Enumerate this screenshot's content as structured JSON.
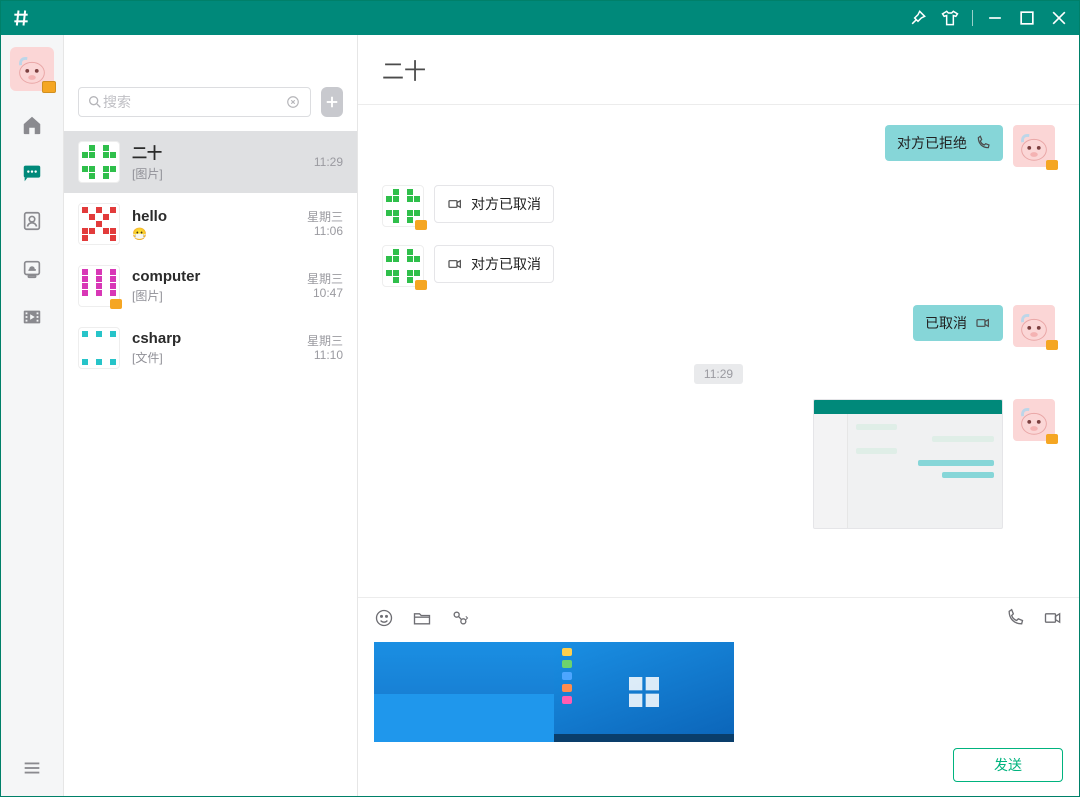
{
  "colors": {
    "brand": "#00897a",
    "bubble_right": "#86d6d8",
    "send_border": "#00b37e"
  },
  "titlebar": {
    "logo_name": "logo-icon"
  },
  "search": {
    "placeholder": "搜索"
  },
  "chat_title": "二十",
  "conversations": [
    {
      "name": "二十",
      "preview": "[图片]",
      "time1": "",
      "time2": "11:29",
      "avatar": "green",
      "active": true
    },
    {
      "name": "hello",
      "preview": "😷",
      "time1": "星期三",
      "time2": "11:06",
      "avatar": "red",
      "active": false
    },
    {
      "name": "computer",
      "preview": "[图片]",
      "time1": "星期三",
      "time2": "10:47",
      "avatar": "magenta",
      "active": false,
      "camera": true
    },
    {
      "name": "csharp",
      "preview": "[文件]",
      "time1": "星期三",
      "time2": "11:10",
      "avatar": "cyan",
      "active": false
    }
  ],
  "messages": [
    {
      "side": "right",
      "avatar": "pink",
      "type": "call",
      "text": "对方已拒绝",
      "icon": "phone"
    },
    {
      "side": "left",
      "avatar": "green",
      "type": "call",
      "text": "对方已取消",
      "icon": "video"
    },
    {
      "side": "left",
      "avatar": "green",
      "type": "call",
      "text": "对方已取消",
      "icon": "video"
    },
    {
      "side": "right",
      "avatar": "pink",
      "type": "call",
      "text": "已取消",
      "icon": "video"
    },
    {
      "side": "center",
      "type": "time",
      "text": "11:29"
    },
    {
      "side": "right",
      "avatar": "pink",
      "type": "image"
    }
  ],
  "composer": {
    "send_label": "发送"
  }
}
